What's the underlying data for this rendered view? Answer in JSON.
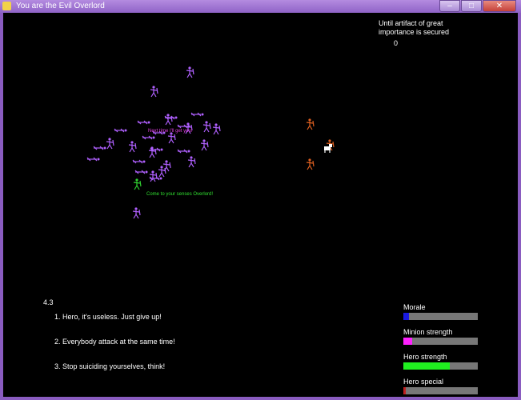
{
  "window": {
    "title": "You are the Evil Overlord"
  },
  "hud": {
    "goal_text": "Until artifact of great importance is secured",
    "counter": "0",
    "round_label": "4.3"
  },
  "speech": {
    "minion": "Next time I'll get you!",
    "recruit": "Come to your senses Overlord!"
  },
  "options": [
    {
      "number": "1.",
      "text": "Hero, it's useless. Just give up!"
    },
    {
      "number": "2.",
      "text": "Everybody attack at the same time!"
    },
    {
      "number": "3.",
      "text": "Stop suiciding yourselves, think!"
    }
  ],
  "bars": [
    {
      "label": "Morale",
      "value": 0.08,
      "color": "#1a1ae0"
    },
    {
      "label": "Minion strength",
      "value": 0.12,
      "color": "#ff20ff"
    },
    {
      "label": "Hero strength",
      "value": 0.62,
      "color": "#20f020"
    },
    {
      "label": "Hero special",
      "value": 0.03,
      "color": "#c02020"
    }
  ],
  "colors": {
    "minion": "#b060ff",
    "hero": "#e06020",
    "recruit": "#30d030",
    "background": "#000000"
  }
}
